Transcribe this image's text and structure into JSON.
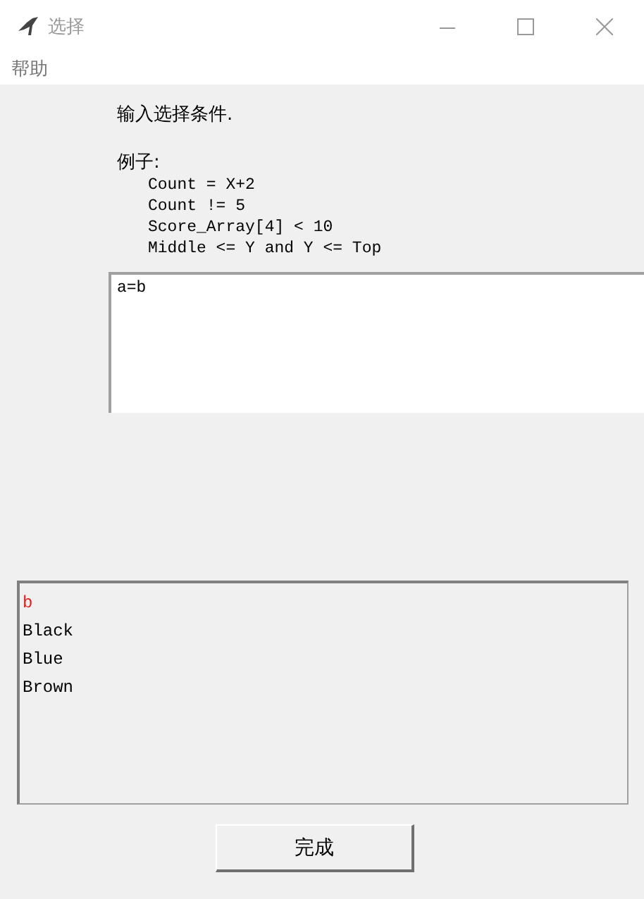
{
  "window": {
    "title": "选择"
  },
  "menu": [
    "帮助"
  ],
  "prompt": "输入选择条件.",
  "examples_label": "例子:",
  "examples": [
    "Count = X+2",
    "Count != 5",
    "Score_Array[4] < 10",
    "Middle <= Y and Y <= Top"
  ],
  "condition": {
    "value": "a=b"
  },
  "list": [
    {
      "text": "b",
      "color": "#e02020"
    },
    {
      "text": "Black",
      "color": "#000000"
    },
    {
      "text": "Blue",
      "color": "#000000"
    },
    {
      "text": "Brown",
      "color": "#000000"
    }
  ],
  "buttons": [
    "完成"
  ]
}
